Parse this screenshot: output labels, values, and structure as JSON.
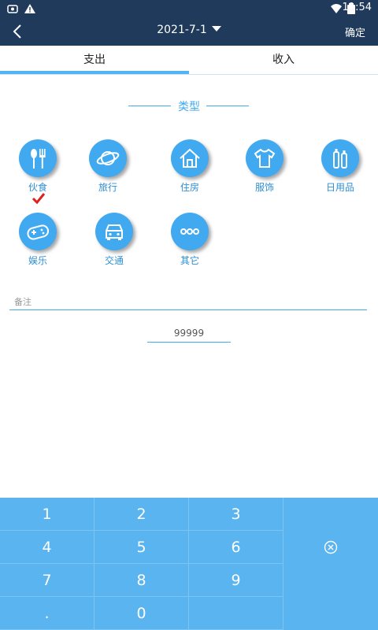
{
  "status_bar": {
    "time": "11:54"
  },
  "toolbar": {
    "title": "2021-7-1",
    "confirm_label": "确定"
  },
  "tabs": [
    {
      "label": "支出"
    },
    {
      "label": "收入"
    }
  ],
  "section": {
    "title": "类型"
  },
  "categories": [
    {
      "label": "伙食",
      "icon": "cutlery-icon"
    },
    {
      "label": "旅行",
      "icon": "planet-icon"
    },
    {
      "label": "住房",
      "icon": "house-icon"
    },
    {
      "label": "服饰",
      "icon": "tshirt-icon"
    },
    {
      "label": "日用品",
      "icon": "bottles-icon"
    },
    {
      "label": "娱乐",
      "icon": "gamepad-icon"
    },
    {
      "label": "交通",
      "icon": "car-icon"
    },
    {
      "label": "其它",
      "icon": "more-dots-icon"
    }
  ],
  "form": {
    "note_placeholder": "备注",
    "amount_value": "99999"
  },
  "keypad": {
    "keys": [
      "1",
      "2",
      "3",
      "4",
      "5",
      "6",
      "7",
      "8",
      "9",
      ".",
      "0"
    ],
    "delete_icon": "clear-circle-icon"
  },
  "colors": {
    "primary": "#41a9ef",
    "toolbar": "#1f3a5a",
    "keypad": "#5ab4f0",
    "check": "#e0201e"
  }
}
